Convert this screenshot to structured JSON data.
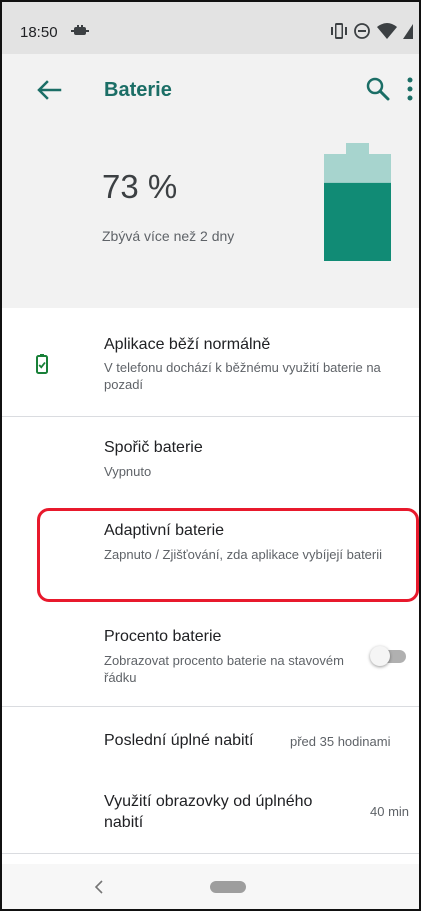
{
  "status_bar": {
    "time": "18:50",
    "icons": [
      "notification-icon",
      "vibrate-icon",
      "do-not-disturb-icon",
      "wifi-icon",
      "cell-signal-icon"
    ]
  },
  "app_bar": {
    "title": "Baterie",
    "back_icon": "arrow-back-icon",
    "search_icon": "search-icon",
    "more_icon": "more-vert-icon"
  },
  "battery": {
    "percent_text": "73 %",
    "level": 0.73,
    "remaining": "Zbývá více než 2 dny",
    "colors": {
      "fill": "#118b75",
      "empty": "#a7d4ce"
    }
  },
  "items": {
    "app_status": {
      "title": "Aplikace běží normálně",
      "subtitle": "V telefonu dochází k běžnému využití baterie na pozadí",
      "icon": "battery-check-icon",
      "icon_color": "#188038"
    },
    "battery_saver": {
      "title": "Spořič baterie",
      "subtitle": "Vypnuto"
    },
    "adaptive_battery": {
      "title": "Adaptivní baterie",
      "subtitle": "Zapnuto / Zjišťování, zda aplikace vybíjejí baterii"
    },
    "battery_percentage": {
      "title": "Procento baterie",
      "subtitle": "Zobrazovat procento baterie na stavovém řádku",
      "toggle_on": false
    },
    "last_full_charge": {
      "title": "Poslední úplné nabití",
      "value": "před 35 hodinami"
    },
    "screen_usage": {
      "title": "Využití obrazovky od úplného nabití",
      "value": "40 min"
    }
  },
  "nav_bar": {
    "back_icon": "nav-back-icon",
    "home_icon": "home-pill-icon"
  },
  "accent_colors": {
    "title": "#1b6e66",
    "highlight": "#e8192c"
  }
}
